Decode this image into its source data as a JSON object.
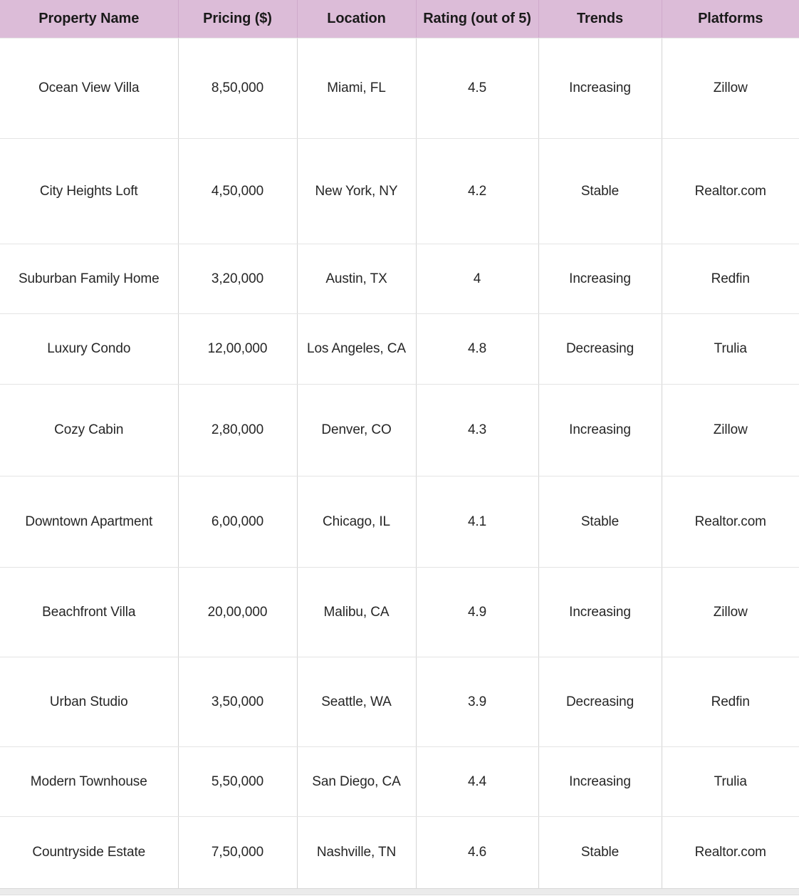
{
  "table": {
    "columns": [
      {
        "key": "property_name",
        "label": "Property Name"
      },
      {
        "key": "pricing",
        "label": "Pricing ($)"
      },
      {
        "key": "location",
        "label": "Location"
      },
      {
        "key": "rating",
        "label": "Rating (out of 5)"
      },
      {
        "key": "trends",
        "label": "Trends"
      },
      {
        "key": "platforms",
        "label": "Platforms"
      }
    ],
    "header_bg": "#dcbcd8",
    "header_divider": "#cfa9cb",
    "body_divider": "#d4d4d4",
    "text_color": "#262626",
    "rows": [
      {
        "property_name": "Ocean View Villa",
        "pricing": "8,50,000",
        "location": "Miami, FL",
        "rating": "4.5",
        "trends": "Increasing",
        "platforms": "Zillow"
      },
      {
        "property_name": "City Heights Loft",
        "pricing": "4,50,000",
        "location": "New York, NY",
        "rating": "4.2",
        "trends": "Stable",
        "platforms": "Realtor.com"
      },
      {
        "property_name": "Suburban Family Home",
        "pricing": "3,20,000",
        "location": "Austin, TX",
        "rating": "4",
        "trends": "Increasing",
        "platforms": "Redfin"
      },
      {
        "property_name": "Luxury Condo",
        "pricing": "12,00,000",
        "location": "Los Angeles, CA",
        "rating": "4.8",
        "trends": "Decreasing",
        "platforms": "Trulia"
      },
      {
        "property_name": "Cozy Cabin",
        "pricing": "2,80,000",
        "location": "Denver, CO",
        "rating": "4.3",
        "trends": "Increasing",
        "platforms": "Zillow"
      },
      {
        "property_name": "Downtown Apartment",
        "pricing": "6,00,000",
        "location": "Chicago, IL",
        "rating": "4.1",
        "trends": "Stable",
        "platforms": "Realtor.com"
      },
      {
        "property_name": "Beachfront Villa",
        "pricing": "20,00,000",
        "location": "Malibu, CA",
        "rating": "4.9",
        "trends": "Increasing",
        "platforms": "Zillow"
      },
      {
        "property_name": "Urban Studio",
        "pricing": "3,50,000",
        "location": "Seattle, WA",
        "rating": "3.9",
        "trends": "Decreasing",
        "platforms": "Redfin"
      },
      {
        "property_name": "Modern Townhouse",
        "pricing": "5,50,000",
        "location": "San Diego, CA",
        "rating": "4.4",
        "trends": "Increasing",
        "platforms": "Trulia"
      },
      {
        "property_name": "Countryside Estate",
        "pricing": "7,50,000",
        "location": "Nashville, TN",
        "rating": "4.6",
        "trends": "Stable",
        "platforms": "Realtor.com"
      }
    ]
  },
  "chart_data": {
    "type": "table",
    "title": "",
    "columns": [
      "Property Name",
      "Pricing ($)",
      "Location",
      "Rating (out of 5)",
      "Trends",
      "Platforms"
    ],
    "rows": [
      [
        "Ocean View Villa",
        "8,50,000",
        "Miami, FL",
        "4.5",
        "Increasing",
        "Zillow"
      ],
      [
        "City Heights Loft",
        "4,50,000",
        "New York, NY",
        "4.2",
        "Stable",
        "Realtor.com"
      ],
      [
        "Suburban Family Home",
        "3,20,000",
        "Austin, TX",
        "4",
        "Increasing",
        "Redfin"
      ],
      [
        "Luxury Condo",
        "12,00,000",
        "Los Angeles, CA",
        "4.8",
        "Decreasing",
        "Trulia"
      ],
      [
        "Cozy Cabin",
        "2,80,000",
        "Denver, CO",
        "4.3",
        "Increasing",
        "Zillow"
      ],
      [
        "Downtown Apartment",
        "6,00,000",
        "Chicago, IL",
        "4.1",
        "Stable",
        "Realtor.com"
      ],
      [
        "Beachfront Villa",
        "20,00,000",
        "Malibu, CA",
        "4.9",
        "Increasing",
        "Zillow"
      ],
      [
        "Urban Studio",
        "3,50,000",
        "Seattle, WA",
        "3.9",
        "Decreasing",
        "Redfin"
      ],
      [
        "Modern Townhouse",
        "5,50,000",
        "San Diego, CA",
        "4.4",
        "Increasing",
        "Trulia"
      ],
      [
        "Countryside Estate",
        "7,50,000",
        "Nashville, TN",
        "4.6",
        "Stable",
        "Realtor.com"
      ]
    ]
  }
}
